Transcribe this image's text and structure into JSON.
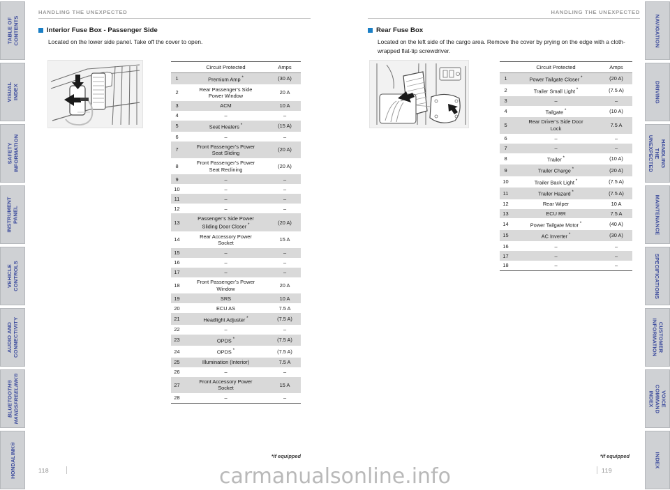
{
  "tabs_left": [
    {
      "label": "TABLE OF CONTENTS",
      "italic": false
    },
    {
      "label": "VISUAL INDEX",
      "italic": false
    },
    {
      "label": "SAFETY\nINFORMATION",
      "italic": false
    },
    {
      "label": "INSTRUMENT PANEL",
      "italic": false
    },
    {
      "label": "VEHICLE\nCONTROLS",
      "italic": false
    },
    {
      "label": "AUDIO AND\nCONNECTIVITY",
      "italic": false
    },
    {
      "label": "BLUETOOTH®\nHANDSFREELINK®",
      "italic": true
    },
    {
      "label": "HONDALINK®",
      "italic": false
    }
  ],
  "tabs_right": [
    {
      "label": "NAVIGATION"
    },
    {
      "label": "DRIVING"
    },
    {
      "label": "HANDLING THE\nUNEXPECTED"
    },
    {
      "label": "MAINTENANCE"
    },
    {
      "label": "SPECIFICATIONS"
    },
    {
      "label": "CUSTOMER\nINFORMATION"
    },
    {
      "label": "VOICE COMMAND\nINDEX"
    },
    {
      "label": "INDEX"
    }
  ],
  "left_page": {
    "running_head": "HANDLING THE UNEXPECTED",
    "section_title": "Interior Fuse Box - Passenger Side",
    "section_body": "Located on the lower side panel. Take off the cover to open.",
    "illustration_name": "interior-fuse-box-passenger-side-illustration",
    "footnote": "*if equipped",
    "page_number": "118",
    "table": {
      "headers": [
        "",
        "Circuit Protected",
        "Amps"
      ],
      "rows": [
        {
          "num": "1",
          "circuit": "Premium Amp",
          "star": true,
          "amps": "(30 A)",
          "shade": true
        },
        {
          "num": "2",
          "circuit": "Rear Passenger’s Side\nPower Window",
          "star": false,
          "amps": "20 A",
          "shade": false
        },
        {
          "num": "3",
          "circuit": "ACM",
          "star": false,
          "amps": "10 A",
          "shade": true
        },
        {
          "num": "4",
          "circuit": "–",
          "star": false,
          "amps": "–",
          "shade": false
        },
        {
          "num": "5",
          "circuit": "Seat Heaters",
          "star": true,
          "amps": "(15 A)",
          "shade": true
        },
        {
          "num": "6",
          "circuit": "–",
          "star": false,
          "amps": "–",
          "shade": false
        },
        {
          "num": "7",
          "circuit": "Front Passenger’s Power\nSeat Sliding",
          "star": false,
          "amps": "(20 A)",
          "shade": true
        },
        {
          "num": "8",
          "circuit": "Front Passenger’s Power\nSeat Reclining",
          "star": false,
          "amps": "(20 A)",
          "shade": false
        },
        {
          "num": "9",
          "circuit": "–",
          "star": false,
          "amps": "–",
          "shade": true
        },
        {
          "num": "10",
          "circuit": "–",
          "star": false,
          "amps": "–",
          "shade": false
        },
        {
          "num": "11",
          "circuit": "–",
          "star": false,
          "amps": "–",
          "shade": true
        },
        {
          "num": "12",
          "circuit": "–",
          "star": false,
          "amps": "–",
          "shade": false
        },
        {
          "num": "13",
          "circuit": "Passenger’s Side Power\nSliding Door Closer",
          "star": true,
          "amps": "(20 A)",
          "shade": true
        },
        {
          "num": "14",
          "circuit": "Rear Accessory Power\nSocket",
          "star": false,
          "amps": "15 A",
          "shade": false
        },
        {
          "num": "15",
          "circuit": "–",
          "star": false,
          "amps": "–",
          "shade": true
        },
        {
          "num": "16",
          "circuit": "–",
          "star": false,
          "amps": "–",
          "shade": false
        },
        {
          "num": "17",
          "circuit": "–",
          "star": false,
          "amps": "–",
          "shade": true
        },
        {
          "num": "18",
          "circuit": "Front Passenger’s Power\nWindow",
          "star": false,
          "amps": "20 A",
          "shade": false
        },
        {
          "num": "19",
          "circuit": "SRS",
          "star": false,
          "amps": "10 A",
          "shade": true
        },
        {
          "num": "20",
          "circuit": "ECU AS",
          "star": false,
          "amps": "7.5 A",
          "shade": false
        },
        {
          "num": "21",
          "circuit": "Headlight Adjuster",
          "star": true,
          "amps": "(7.5 A)",
          "shade": true
        },
        {
          "num": "22",
          "circuit": "–",
          "star": false,
          "amps": "–",
          "shade": false
        },
        {
          "num": "23",
          "circuit": "OPDS",
          "star": true,
          "amps": "(7.5 A)",
          "shade": true
        },
        {
          "num": "24",
          "circuit": "OPDS",
          "star": true,
          "amps": "(7.5 A)",
          "shade": false
        },
        {
          "num": "25",
          "circuit": "Illumination (Interior)",
          "star": false,
          "amps": "7.5 A",
          "shade": true
        },
        {
          "num": "26",
          "circuit": "–",
          "star": false,
          "amps": "–",
          "shade": false
        },
        {
          "num": "27",
          "circuit": "Front Accessory Power\nSocket",
          "star": false,
          "amps": "15 A",
          "shade": true
        },
        {
          "num": "28",
          "circuit": "–",
          "star": false,
          "amps": "–",
          "shade": false
        }
      ]
    }
  },
  "right_page": {
    "running_head": "HANDLING THE UNEXPECTED",
    "section_title": "Rear Fuse Box",
    "section_body": "Located on the left side of the cargo area. Remove the cover by prying on the edge with a cloth-wrapped flat-tip screwdriver.",
    "illustration_name": "rear-fuse-box-illustration",
    "footnote": "*if equipped",
    "page_number": "119",
    "table": {
      "headers": [
        "",
        "Circuit Protected",
        "Amps"
      ],
      "rows": [
        {
          "num": "1",
          "circuit": "Power Tailgate Closer",
          "star": true,
          "amps": "(20 A)",
          "shade": true
        },
        {
          "num": "2",
          "circuit": "Trailer Small Light",
          "star": true,
          "amps": "(7.5 A)",
          "shade": false
        },
        {
          "num": "3",
          "circuit": "–",
          "star": false,
          "amps": "–",
          "shade": true
        },
        {
          "num": "4",
          "circuit": "Tailgate",
          "star": true,
          "amps": "(10 A)",
          "shade": false
        },
        {
          "num": "5",
          "circuit": "Rear Driver’s Side Door\nLock",
          "star": false,
          "amps": "7.5 A",
          "shade": true
        },
        {
          "num": "6",
          "circuit": "–",
          "star": false,
          "amps": "–",
          "shade": false
        },
        {
          "num": "7",
          "circuit": "–",
          "star": false,
          "amps": "–",
          "shade": true
        },
        {
          "num": "8",
          "circuit": "Trailer",
          "star": true,
          "amps": "(10 A)",
          "shade": false
        },
        {
          "num": "9",
          "circuit": "Trailer Charge",
          "star": true,
          "amps": "(20 A)",
          "shade": true
        },
        {
          "num": "10",
          "circuit": "Trailer Back Light",
          "star": true,
          "amps": "(7.5 A)",
          "shade": false
        },
        {
          "num": "11",
          "circuit": "Trailer Hazard",
          "star": true,
          "amps": "(7.5 A)",
          "shade": true
        },
        {
          "num": "12",
          "circuit": "Rear Wiper",
          "star": false,
          "amps": "10 A",
          "shade": false
        },
        {
          "num": "13",
          "circuit": "ECU RR",
          "star": false,
          "amps": "7.5 A",
          "shade": true
        },
        {
          "num": "14",
          "circuit": "Power Tailgate Motor",
          "star": true,
          "amps": "(40 A)",
          "shade": false
        },
        {
          "num": "15",
          "circuit": "AC Inverter",
          "star": true,
          "amps": "(30 A)",
          "shade": true
        },
        {
          "num": "16",
          "circuit": "–",
          "star": false,
          "amps": "–",
          "shade": false
        },
        {
          "num": "17",
          "circuit": "–",
          "star": false,
          "amps": "–",
          "shade": true
        },
        {
          "num": "18",
          "circuit": "–",
          "star": false,
          "amps": "–",
          "shade": false
        }
      ]
    }
  },
  "watermark": "carmanualsonline.info",
  "colors": {
    "accent_blue": "#1a7fc6",
    "tab_text": "#3b4a9c",
    "tab_bg": "#cfd1d4",
    "row_shade": "#d9d9d9"
  }
}
